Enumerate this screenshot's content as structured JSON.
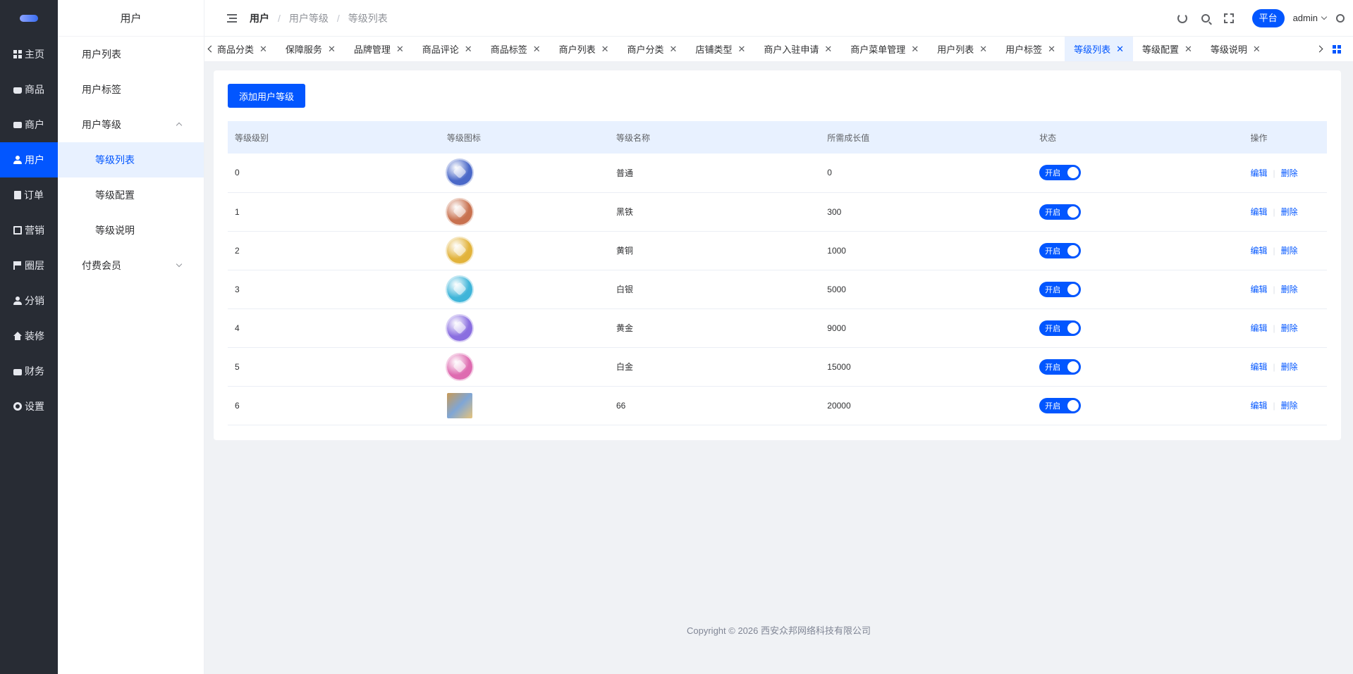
{
  "rail": {
    "items": [
      {
        "label": "主页",
        "icon": "dashboard-icon"
      },
      {
        "label": "商品",
        "icon": "bag-icon"
      },
      {
        "label": "商户",
        "icon": "shop-icon"
      },
      {
        "label": "用户",
        "icon": "user-icon"
      },
      {
        "label": "订单",
        "icon": "order-icon"
      },
      {
        "label": "营销",
        "icon": "chart-icon"
      },
      {
        "label": "圈层",
        "icon": "flag-icon"
      },
      {
        "label": "分销",
        "icon": "distribution-icon"
      },
      {
        "label": "装修",
        "icon": "home-icon"
      },
      {
        "label": "财务",
        "icon": "wallet-icon"
      },
      {
        "label": "设置",
        "icon": "gear-icon"
      }
    ],
    "active_index": 3
  },
  "submenu": {
    "title": "用户",
    "items": [
      {
        "label": "用户列表"
      },
      {
        "label": "用户标签"
      },
      {
        "label": "用户等级"
      },
      {
        "label": "等级列表"
      },
      {
        "label": "等级配置"
      },
      {
        "label": "等级说明"
      },
      {
        "label": "付费会员"
      }
    ]
  },
  "header": {
    "breadcrumb": [
      "用户",
      "用户等级",
      "等级列表"
    ],
    "platform_label": "平台",
    "user_label": "admin"
  },
  "tags": [
    {
      "label": "商品分类"
    },
    {
      "label": "保障服务"
    },
    {
      "label": "品牌管理"
    },
    {
      "label": "商品评论"
    },
    {
      "label": "商品标签"
    },
    {
      "label": "商户列表"
    },
    {
      "label": "商户分类"
    },
    {
      "label": "店铺类型"
    },
    {
      "label": "商户入驻申请"
    },
    {
      "label": "商户菜单管理"
    },
    {
      "label": "用户列表"
    },
    {
      "label": "用户标签"
    },
    {
      "label": "等级列表",
      "active": true
    },
    {
      "label": "等级配置"
    },
    {
      "label": "等级说明"
    }
  ],
  "content": {
    "add_button_label": "添加用户等级",
    "columns": [
      "等级级别",
      "等级图标",
      "等级名称",
      "所需成长值",
      "状态",
      "操作"
    ],
    "rows": [
      {
        "level": "0",
        "name": "普通",
        "growth": "0",
        "status": "开启",
        "icon_color": "#4a68c8"
      },
      {
        "level": "1",
        "name": "黑铁",
        "growth": "300",
        "status": "开启",
        "icon_color": "#c8714f"
      },
      {
        "level": "2",
        "name": "黄铜",
        "growth": "1000",
        "status": "开启",
        "icon_color": "#e2b33c"
      },
      {
        "level": "3",
        "name": "白银",
        "growth": "5000",
        "status": "开启",
        "icon_color": "#3fb5d9"
      },
      {
        "level": "4",
        "name": "黄金",
        "growth": "9000",
        "status": "开启",
        "icon_color": "#8a6ee0"
      },
      {
        "level": "5",
        "name": "白金",
        "growth": "15000",
        "status": "开启",
        "icon_color": "#de6bb0"
      },
      {
        "level": "6",
        "name": "66",
        "growth": "20000",
        "status": "开启",
        "icon_color": "#c99a55"
      }
    ],
    "edit_label": "编辑",
    "delete_label": "删除"
  },
  "footer": {
    "copyright": "Copyright © 2026 西安众邦网络科技有限公司"
  },
  "colors": {
    "primary": "#0256ff",
    "rail_bg": "#282c34",
    "active_bg": "#e8f1ff"
  }
}
